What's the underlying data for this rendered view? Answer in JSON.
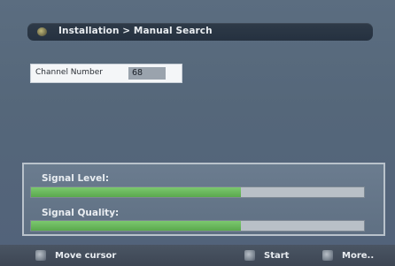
{
  "header": {
    "title": "Installation > Manual Search",
    "icon": "disc-icon"
  },
  "channel": {
    "label": "Channel Number",
    "value": "68"
  },
  "signal": {
    "level_label": "Signal Level:",
    "level_fraction": 0.63,
    "quality_label": "Signal Quality:",
    "quality_fraction": 0.63,
    "fill_color": "#6cb95f"
  },
  "footer": {
    "move_label": "Move cursor",
    "move_icon": "move-cursor-icon",
    "start_label": "Start",
    "start_icon": "enter-icon",
    "more_label": "More..",
    "more_icon": "menu-icon"
  }
}
